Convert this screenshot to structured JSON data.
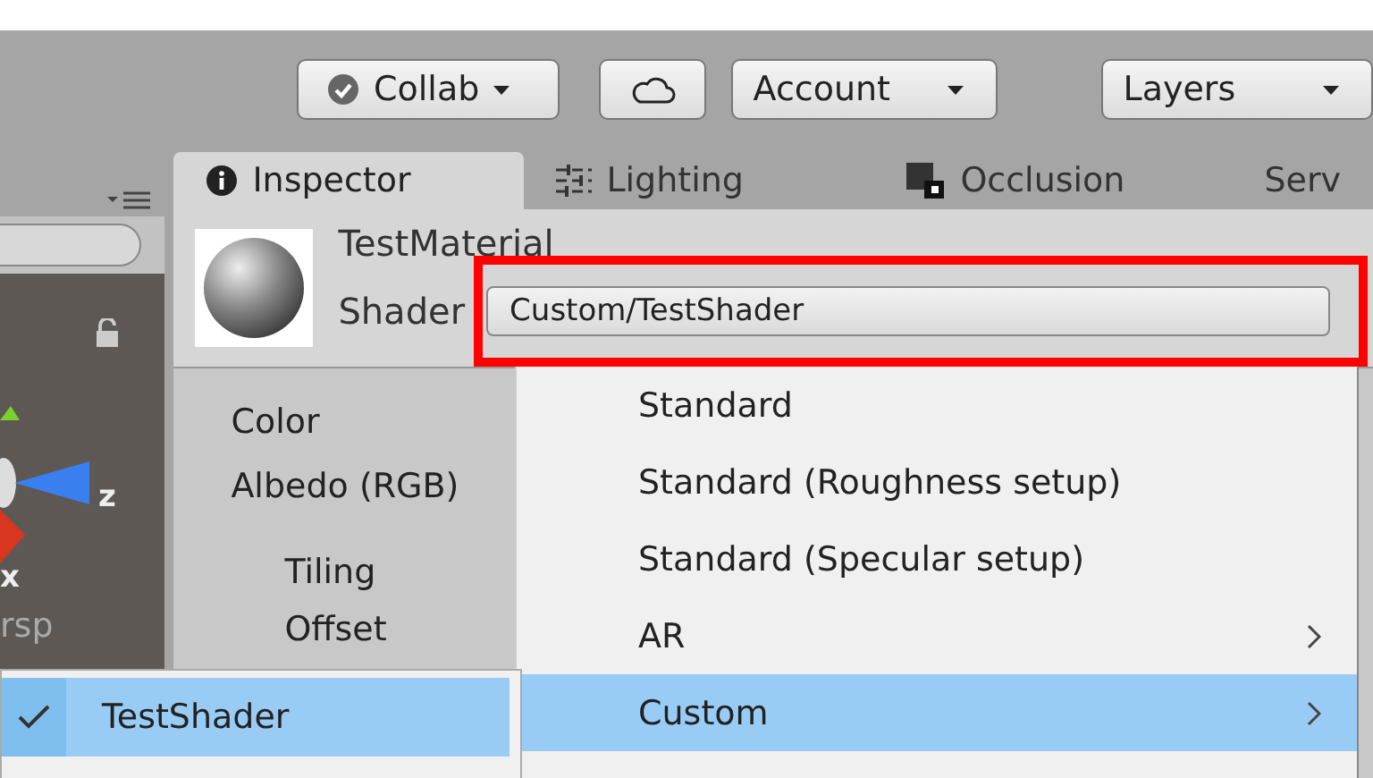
{
  "toolbar": {
    "buttons": [
      {
        "kind": "collab",
        "label": "Collab"
      },
      {
        "kind": "cloud"
      },
      {
        "kind": "dropdown",
        "label": "Account"
      },
      {
        "kind": "dropdown",
        "label": "Layers"
      }
    ]
  },
  "scene": {
    "axis_labels": [
      "z",
      "x"
    ],
    "projection": "rsp"
  },
  "tabs": [
    {
      "label": "Inspector",
      "selected": true
    },
    {
      "label": "Lighting",
      "selected": false
    },
    {
      "label": "Occlusion",
      "selected": false
    },
    {
      "label": "Serv",
      "selected": false
    }
  ],
  "material": {
    "name": "TestMaterial",
    "shader_label": "Shader",
    "shader_value": "Custom/TestShader"
  },
  "properties": [
    {
      "label": "Color",
      "indented": false
    },
    {
      "label": "Albedo (RGB)",
      "indented": false
    },
    {
      "label": "Tiling",
      "indented": true
    },
    {
      "label": "Offset",
      "indented": true
    }
  ],
  "shader_menu": [
    {
      "label": "Standard",
      "submenu": false,
      "selected": false
    },
    {
      "label": "Standard (Roughness setup)",
      "submenu": false,
      "selected": false
    },
    {
      "label": "Standard (Specular setup)",
      "submenu": false,
      "selected": false
    },
    {
      "label": "AR",
      "submenu": true,
      "selected": false
    },
    {
      "label": "Custom",
      "submenu": true,
      "selected": true
    }
  ],
  "submenu": [
    {
      "label": "TestShader",
      "checked": true,
      "selected": true
    }
  ]
}
